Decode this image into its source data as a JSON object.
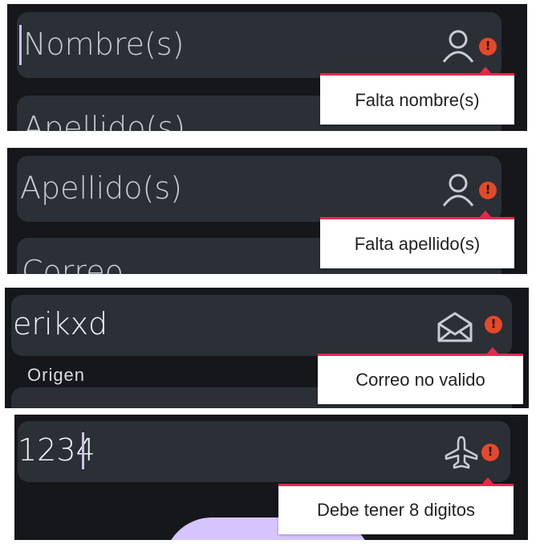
{
  "panels": [
    {
      "field_placeholder": "Nombre(s)",
      "next_field_partial": "Apellido(s)",
      "error_message": "Falta nombre(s)",
      "icon": "person-icon"
    },
    {
      "field_placeholder": "Apellido(s)",
      "next_field_partial": "Correo",
      "error_message": "Falta apellido(s)",
      "icon": "person-icon"
    },
    {
      "field_value": "erikxd",
      "section_label": "Origen",
      "error_message": "Correo no valido",
      "icon": "envelope-open-icon"
    },
    {
      "field_value": "1234",
      "error_message": "Debe tener 8 digitos",
      "icon": "airplane-icon"
    }
  ],
  "colors": {
    "background": "#15171b",
    "field": "#2b2f36",
    "error": "#e4492a",
    "tooltip_border": "#e8284a",
    "accent": "#d6c4ff"
  }
}
